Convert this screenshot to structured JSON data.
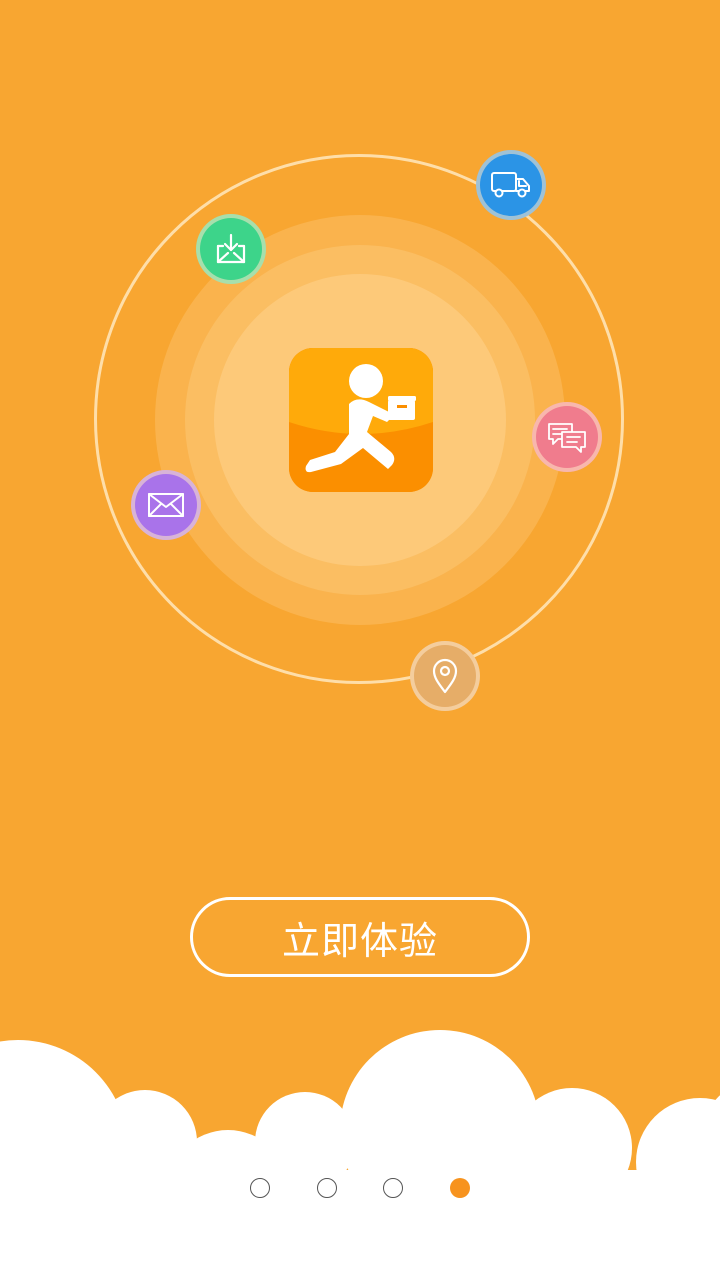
{
  "colors": {
    "background": "#f8a631",
    "cloud": "#ffffff",
    "active_dot": "#f7931e",
    "inbox_badge": "#3dd48a",
    "truck_badge": "#2b94e6",
    "chat_badge": "#f07c8d",
    "mail_badge": "#a973ea",
    "pin_badge": "#e6ad68"
  },
  "icons": {
    "center": "courier-logo-icon",
    "features": [
      "inbox-download-icon",
      "truck-icon",
      "chat-icon",
      "mail-icon",
      "location-pin-icon"
    ]
  },
  "cta": {
    "label": "立即体验"
  },
  "pagination": {
    "total": 4,
    "current": 4
  }
}
